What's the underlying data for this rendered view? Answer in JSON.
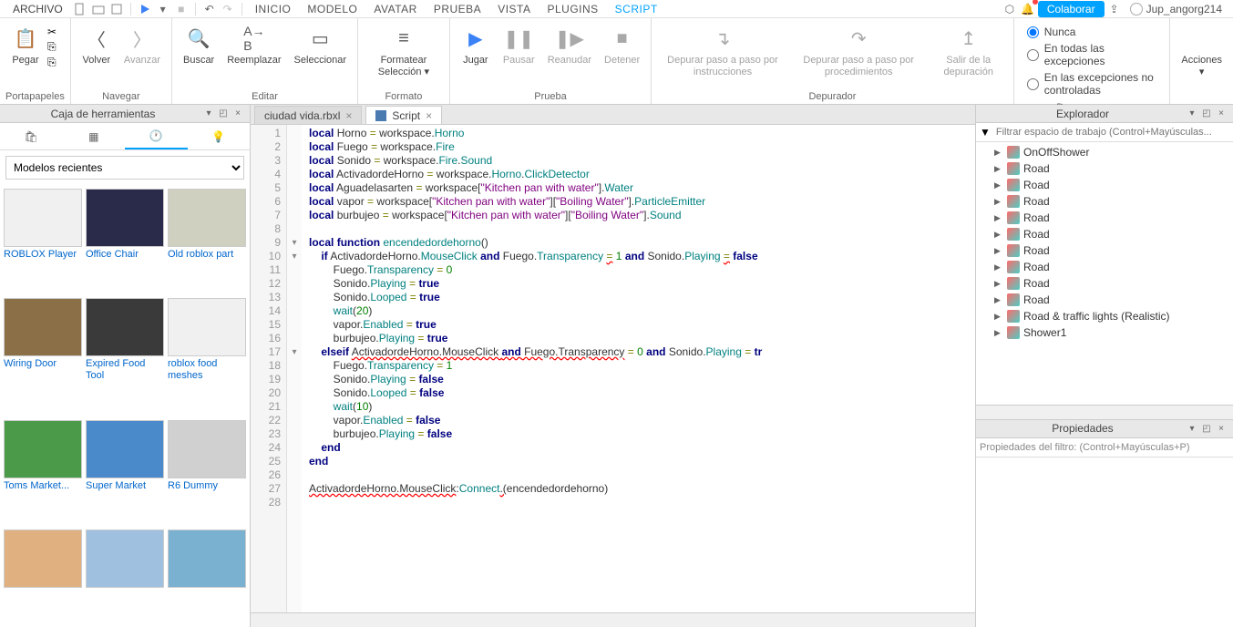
{
  "topbar": {
    "file": "ARCHIVO",
    "menus": [
      "INICIO",
      "MODELO",
      "AVATAR",
      "PRUEBA",
      "VISTA",
      "PLUGINS",
      "SCRIPT"
    ],
    "active_menu": 6,
    "collab": "Colaborar",
    "user": "Jup_angorg214"
  },
  "ribbon": {
    "groups": [
      {
        "label": "Portapapeles",
        "buttons": [
          {
            "text": "\nPegar",
            "icon": "clipboard"
          }
        ]
      },
      {
        "label": "Navegar",
        "buttons": [
          {
            "text": "Volver",
            "icon": "back"
          },
          {
            "text": "Avanzar",
            "icon": "fwd",
            "disabled": true
          }
        ]
      },
      {
        "label": "Editar",
        "buttons": [
          {
            "text": "Buscar",
            "icon": "search"
          },
          {
            "text": "Reemplazar",
            "icon": "replace"
          },
          {
            "text": "Seleccionar",
            "icon": "select"
          }
        ]
      },
      {
        "label": "Formato",
        "buttons": [
          {
            "text": "Formatear\nSelección ▾",
            "icon": "format"
          }
        ]
      },
      {
        "label": "Prueba",
        "buttons": [
          {
            "text": "Jugar",
            "icon": "play"
          },
          {
            "text": "Pausar",
            "icon": "pause",
            "disabled": true
          },
          {
            "text": "Reanudar",
            "icon": "resume",
            "disabled": true
          },
          {
            "text": "Detener",
            "icon": "stop",
            "disabled": true
          }
        ]
      },
      {
        "label": "Depurador",
        "buttons": [
          {
            "text": "Depurar paso a paso\npor instrucciones",
            "icon": "stepin",
            "disabled": true
          },
          {
            "text": "Depurar paso a paso\npor procedimientos",
            "icon": "stepover",
            "disabled": true
          },
          {
            "text": "Salir de la\ndepuración",
            "icon": "stepout",
            "disabled": true
          }
        ]
      },
      {
        "label": "Depurar errores",
        "radios": [
          {
            "label": "Nunca",
            "checked": true
          },
          {
            "label": "En todas las excepciones",
            "checked": false
          },
          {
            "label": "En las excepciones no controladas",
            "checked": false
          }
        ]
      },
      {
        "label": "",
        "buttons": [
          {
            "text": "Acciones\n▾",
            "icon": ""
          }
        ]
      }
    ]
  },
  "toolbox": {
    "title": "Caja de herramientas",
    "dropdown": "Modelos recientes",
    "items": [
      {
        "name": "ROBLOX Player",
        "bg": "#f0f0f0"
      },
      {
        "name": "Office Chair",
        "bg": "#2a2a4a"
      },
      {
        "name": "Old roblox part",
        "bg": "#d0d0c0"
      },
      {
        "name": "Wiring Door",
        "bg": "#8b6f47"
      },
      {
        "name": "Expired Food Tool",
        "bg": "#3a3a3a"
      },
      {
        "name": "roblox food meshes",
        "bg": "#f0f0f0"
      },
      {
        "name": "Toms Market...",
        "bg": "#4a9a4a"
      },
      {
        "name": "Super Market",
        "bg": "#4a8aca"
      },
      {
        "name": "R6 Dummy",
        "bg": "#d0d0d0"
      },
      {
        "name": "",
        "bg": "#e0b080"
      },
      {
        "name": "",
        "bg": "#a0c0e0"
      },
      {
        "name": "",
        "bg": "#7ab0d0"
      }
    ]
  },
  "tabs": [
    {
      "label": "ciudad vida.rbxl",
      "active": false
    },
    {
      "label": "Script",
      "active": true,
      "icon": "script"
    }
  ],
  "code_lines": 28,
  "explorer": {
    "title": "Explorador",
    "filter_placeholder": "Filtrar espacio de trabajo (Control+Mayúsculas...",
    "items": [
      "OnOffShower",
      "Road",
      "Road",
      "Road",
      "Road",
      "Road",
      "Road",
      "Road",
      "Road",
      "Road",
      "Road & traffic lights (Realistic)",
      "Shower1"
    ]
  },
  "properties": {
    "title": "Propiedades",
    "filter_placeholder": "Propiedades del filtro: (Control+Mayúsculas+P)"
  }
}
